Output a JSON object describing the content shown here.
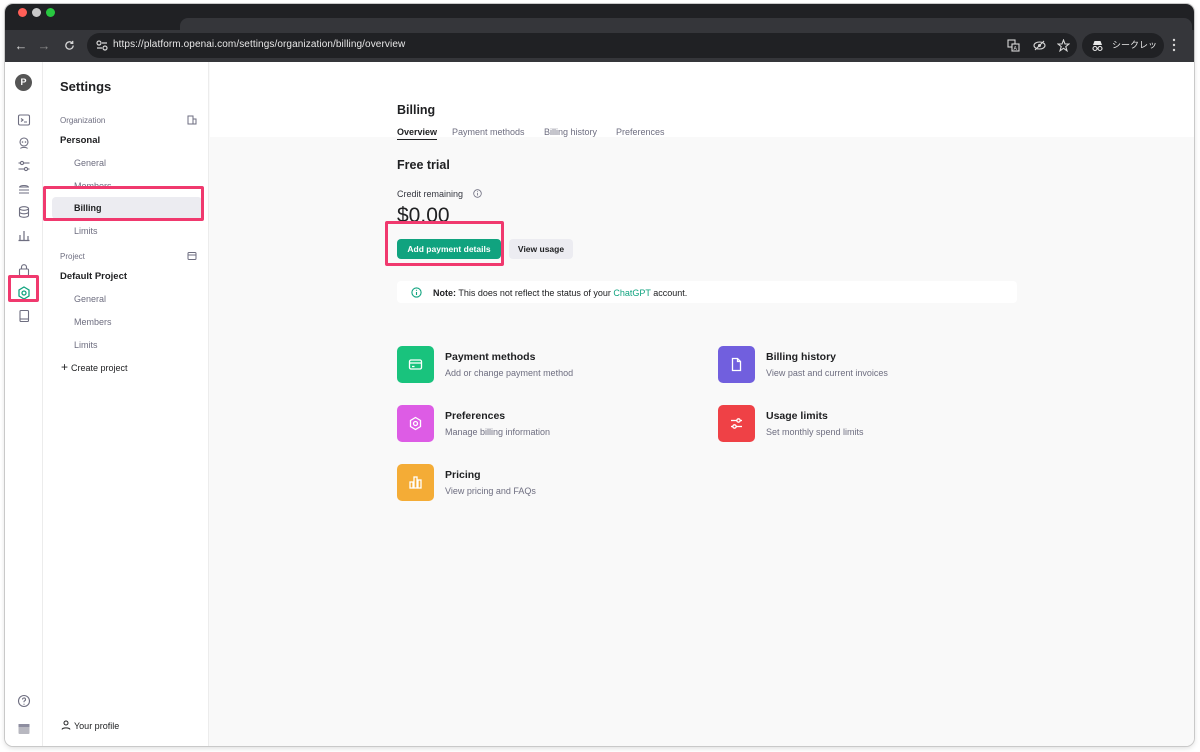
{
  "browser": {
    "url": "https://platform.openai.com/settings/organization/billing/overview",
    "incognito_label": "シークレット"
  },
  "rail": {
    "avatar_letter": "P"
  },
  "sidebar": {
    "title": "Settings",
    "org_section": "Organization",
    "org_group": "Personal",
    "org_items": [
      "General",
      "Members",
      "Billing",
      "Limits"
    ],
    "project_section": "Project",
    "project_group": "Default Project",
    "project_items": [
      "General",
      "Members",
      "Limits"
    ],
    "create_project": "Create project",
    "profile": "Your profile"
  },
  "main": {
    "title": "Billing",
    "tabs": [
      "Overview",
      "Payment methods",
      "Billing history",
      "Preferences"
    ],
    "section_title": "Free trial",
    "credit_label": "Credit remaining",
    "credit_amount": "$0.00",
    "add_payment_label": "Add payment details",
    "view_usage_label": "View usage",
    "note_prefix": "Note:",
    "note_text": " This does not reflect the status of your ",
    "note_link": "ChatGPT",
    "note_suffix": " account."
  },
  "cards": [
    {
      "title": "Payment methods",
      "desc": "Add or change payment method",
      "color": "#19c37d",
      "icon": "credit-card-icon"
    },
    {
      "title": "Billing history",
      "desc": "View past and current invoices",
      "color": "#715fde",
      "icon": "document-icon"
    },
    {
      "title": "Preferences",
      "desc": "Manage billing information",
      "color": "#dd5ce5",
      "icon": "gear-icon"
    },
    {
      "title": "Usage limits",
      "desc": "Set monthly spend limits",
      "color": "#ef4146",
      "icon": "sliders-icon"
    },
    {
      "title": "Pricing",
      "desc": "View pricing and FAQs",
      "color": "#f4ac36",
      "icon": "bar-chart-icon"
    }
  ],
  "colors": {
    "accent": "#10a37f",
    "highlight": "#f0396e"
  }
}
